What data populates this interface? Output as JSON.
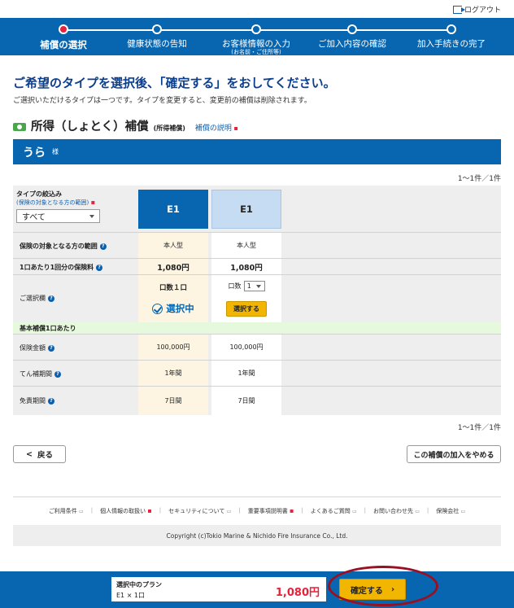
{
  "header": {
    "logout_label": "ログアウト"
  },
  "stepper": {
    "steps": [
      {
        "label": "補償の選択",
        "sub": ""
      },
      {
        "label": "健康状態の告知",
        "sub": ""
      },
      {
        "label": "お客様情報の入力",
        "sub": "(お名前・ご住所等)"
      },
      {
        "label": "ご加入内容の確認",
        "sub": ""
      },
      {
        "label": "加入手続きの完了",
        "sub": ""
      }
    ]
  },
  "main": {
    "heading": "ご希望のタイプを選択後、「確定する」をおしてください。",
    "subtext": "ご選択いただけるタイプは一つです。タイプを変更すると、変更前の補償は削除されます。",
    "section_title": "所得（しょとく）補償",
    "section_title_sub": "(所得補償)",
    "section_link": "補償の説明",
    "insured_name": "うら",
    "honorific": "様",
    "count_top": "1～1件／1件",
    "count_bottom": "1～1件／1件"
  },
  "table": {
    "filter_label": "タイプの絞込み",
    "filter_sub": "(保険の対象となる方の範囲)",
    "filter_value": "すべて",
    "plans": [
      "E1",
      "E1"
    ],
    "rows": {
      "scope": {
        "label": "保険の対象となる方の範囲",
        "values": [
          "本人型",
          "本人型"
        ]
      },
      "premium": {
        "label": "1口あたり1回分の保険料",
        "values": [
          "1,080円",
          "1,080円"
        ]
      },
      "choice": {
        "label": "ご選択欄",
        "units_label": "口数１口",
        "selecting": "選択中",
        "qty_label": "口数",
        "qty_value": "1",
        "select_button": "選択する"
      },
      "band": "基本補償1口あたり",
      "amount": {
        "label": "保険金額",
        "values": [
          "100,000円",
          "100,000円"
        ]
      },
      "period": {
        "label": "てん補期間",
        "values": [
          "1年間",
          "1年間"
        ]
      },
      "exempt": {
        "label": "免責期間",
        "values": [
          "7日間",
          "7日間"
        ]
      }
    }
  },
  "actions": {
    "back_label": "戻る",
    "cancel_label": "この補償の加入をやめる"
  },
  "footer": {
    "links": [
      "ご利用条件",
      "個人情報の取扱い",
      "セキュリティについて",
      "重要事項説明書",
      "よくあるご質問",
      "お問い合わせ先",
      "保険会社"
    ],
    "copyright": "Copyright (c)Tokio Marine & Nichido Fire Insurance Co., Ltd."
  },
  "bottom_bar": {
    "plan_label": "選択中のプラン",
    "plan_qty": "E1 × 1口",
    "price": "1,080円",
    "confirm_label": "確定する"
  },
  "colors": {
    "primary": "#0866b0",
    "accent": "#e6223c",
    "button": "#f2b600"
  }
}
